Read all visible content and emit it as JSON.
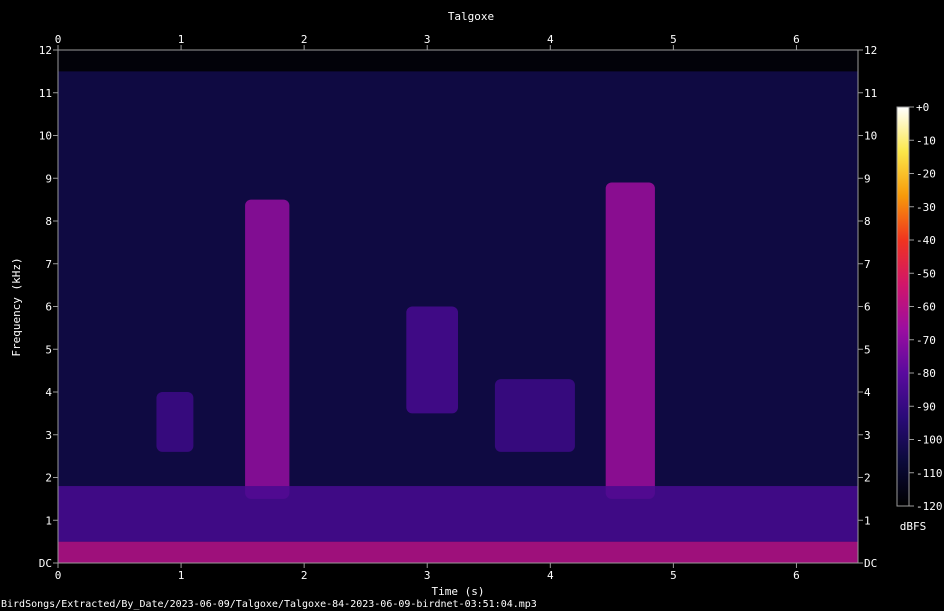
{
  "chart_data": {
    "type": "heatmap",
    "title": "Talgoxe",
    "xlabel": "Time (s)",
    "ylabel": "Frequency (kHz)",
    "xlim": [
      0,
      6.5
    ],
    "ylim": [
      0,
      12
    ],
    "x_ticks": [
      "0",
      "1",
      "2",
      "3",
      "4",
      "5",
      "6"
    ],
    "y_ticks": [
      "DC",
      "1",
      "2",
      "3",
      "4",
      "5",
      "6",
      "7",
      "8",
      "9",
      "10",
      "11",
      "12"
    ],
    "colorbar": {
      "label": "dBFS",
      "range": [
        -120,
        0
      ],
      "ticks": [
        "+0",
        "-10",
        "-20",
        "-30",
        "-40",
        "-50",
        "-60",
        "-70",
        "-80",
        "-90",
        "-100",
        "-110",
        "-120"
      ],
      "colors": [
        "#000000",
        "#0b0a3a",
        "#2a0a78",
        "#5a0a9e",
        "#9c0ea0",
        "#d1156a",
        "#f0341f",
        "#f79a0a",
        "#fbe74a",
        "#ffffff"
      ]
    },
    "background_level_db": -105,
    "signals": [
      {
        "t_start": 1.52,
        "t_end": 1.88,
        "f_low": 1.5,
        "f_high": 8.5,
        "level_db": -68
      },
      {
        "t_start": 4.45,
        "t_end": 4.85,
        "f_low": 1.5,
        "f_high": 8.9,
        "level_db": -66
      },
      {
        "t_start": 2.83,
        "t_end": 3.25,
        "f_low": 3.5,
        "f_high": 6.0,
        "level_db": -85
      },
      {
        "t_start": 0.0,
        "t_end": 6.5,
        "f_low": 0.0,
        "f_high": 0.5,
        "level_db": -60
      },
      {
        "t_start": 0.0,
        "t_end": 6.5,
        "f_low": 0.5,
        "f_high": 1.8,
        "level_db": -85
      },
      {
        "t_start": 0.8,
        "t_end": 1.1,
        "f_low": 2.6,
        "f_high": 4.0,
        "level_db": -88
      },
      {
        "t_start": 3.55,
        "t_end": 4.2,
        "f_low": 2.6,
        "f_high": 4.3,
        "level_db": -88
      }
    ]
  },
  "footer": {
    "path": "BirdSongs/Extracted/By_Date/2023-06-09/Talgoxe/Talgoxe-84-2023-06-09-birdnet-03:51:04.mp3"
  }
}
